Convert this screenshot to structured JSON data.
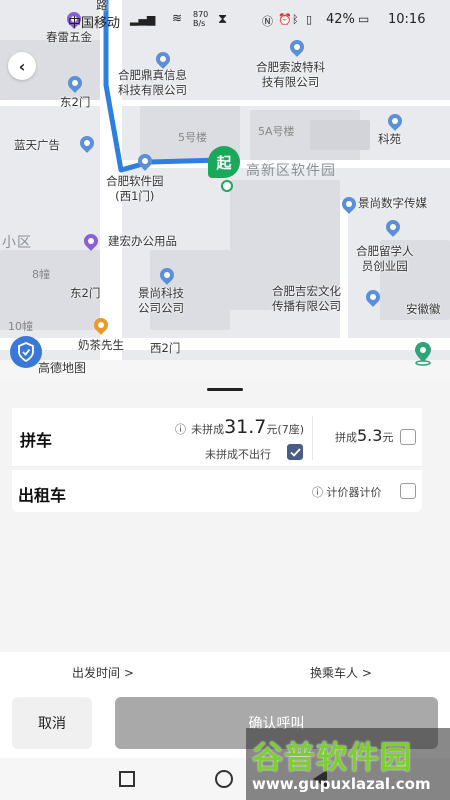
{
  "status_bar": {
    "carrier": "中国移动",
    "speed_value": "870",
    "speed_unit": "B/s",
    "battery": "42%",
    "time": "10:16"
  },
  "map": {
    "road_name": "路",
    "pois": [
      {
        "id": "chunlei",
        "text": "春雷五金"
      },
      {
        "id": "dingzhen",
        "text": "合肥鼎真信息\n科技有限公司"
      },
      {
        "id": "suobote",
        "text": "合肥索波特科\n技有限公司"
      },
      {
        "id": "dong2men_top",
        "text": "东2门"
      },
      {
        "id": "lantian",
        "text": "蓝天广告"
      },
      {
        "id": "ruanjianyuan",
        "text": "合肥软件园\n(西1门)"
      },
      {
        "id": "keyuan",
        "text": "科苑"
      },
      {
        "id": "jingshangshuzi",
        "text": "景尚数字传媒"
      },
      {
        "id": "jianhong",
        "text": "建宏办公用品"
      },
      {
        "id": "liuxueren",
        "text": "合肥留学人\n员创业园"
      },
      {
        "id": "jingshangkeji",
        "text": "景尚科技\n公司公司"
      },
      {
        "id": "jihong",
        "text": "合肥吉宏文化\n传播有限公司"
      },
      {
        "id": "anhuihui",
        "text": "安徽徽"
      },
      {
        "id": "naicha",
        "text": "奶茶先生"
      },
      {
        "id": "xi2men",
        "text": "西2门"
      },
      {
        "id": "dong2men_bottom",
        "text": "东2门"
      },
      {
        "id": "gaode",
        "text": "高德地图"
      }
    ],
    "buildings": [
      "5号楼",
      "5A号楼",
      "8幢",
      "10幢"
    ],
    "district_labels": [
      "高新区软件园",
      "小区"
    ],
    "start_marker": "起"
  },
  "ride_options": {
    "carpool": {
      "label": "拼车",
      "not_pooled_prefix": "未拼成",
      "not_pooled_price": "31.7",
      "not_pooled_suffix": "元(7座)",
      "pooled_prefix": "拼成",
      "pooled_price": "5.3",
      "pooled_suffix": "元",
      "not_pooled_no_go_label": "未拼成不出行",
      "not_pooled_no_go_checked": true,
      "selected": false
    },
    "taxi": {
      "label": "出租车",
      "meter_label": "计价器计价",
      "selected": false
    }
  },
  "options_bar": {
    "departure_time": "出发时间 >",
    "change_passenger": "换乘车人 >"
  },
  "actions": {
    "cancel": "取消",
    "confirm": "确认呼叫"
  },
  "watermark": {
    "brand": "谷普软件园",
    "url": "www.gupuxlazal.com"
  },
  "colors": {
    "route": "#2d7fe0",
    "start_marker": "#1aa85a",
    "confirm_disabled": "#a9a9a9",
    "checked": "#4b5d87"
  }
}
